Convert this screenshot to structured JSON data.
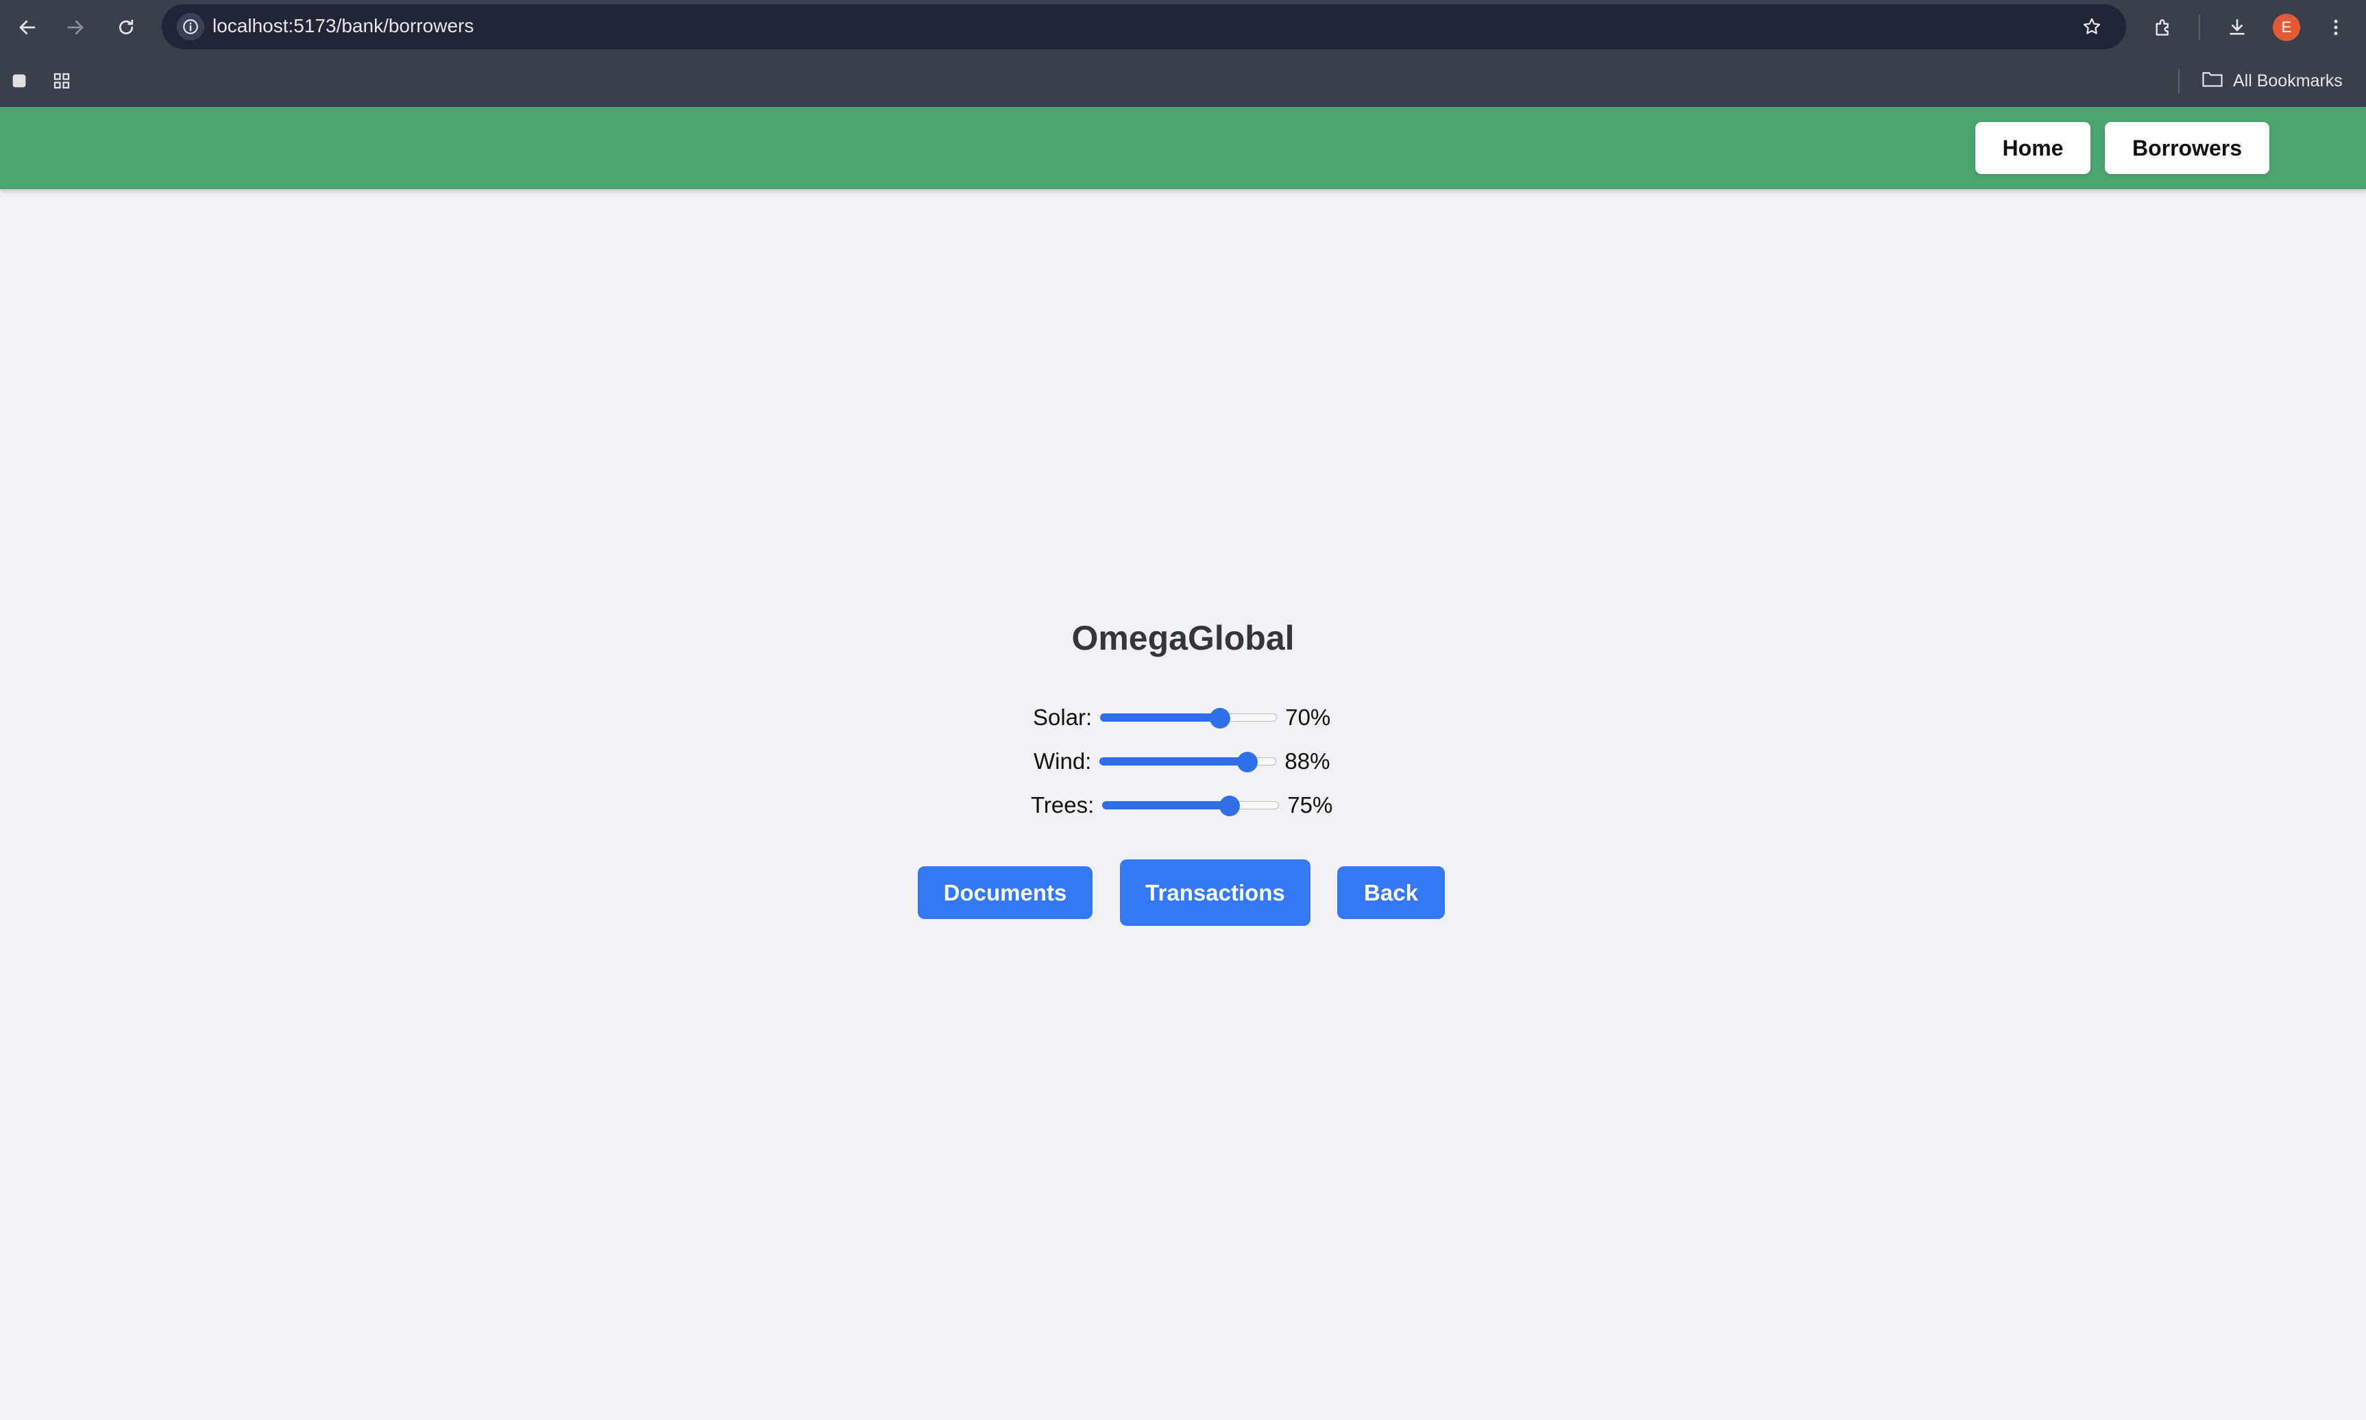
{
  "browser": {
    "url": "localhost:5173/bank/borrowers",
    "avatar_initial": "E",
    "bookmarks_label": "All Bookmarks",
    "icons": [
      "back-arrow-icon",
      "forward-arrow-icon",
      "reload-icon",
      "info-icon",
      "star-icon",
      "extensions-icon",
      "download-icon",
      "kebab-menu-icon",
      "tab-search-icon",
      "apps-grid-icon",
      "folder-icon"
    ]
  },
  "header": {
    "background_color": "#4ba372",
    "home_label": "Home",
    "borrowers_label": "Borrowers"
  },
  "borrower": {
    "name": "OmegaGlobal",
    "sliders": [
      {
        "label": "Solar:",
        "value": 70,
        "display": "70%"
      },
      {
        "label": "Wind:",
        "value": 88,
        "display": "88%"
      },
      {
        "label": "Trees:",
        "value": 75,
        "display": "75%"
      }
    ]
  },
  "actions": {
    "documents_label": "Documents",
    "transactions_label": "Transactions",
    "back_label": "Back",
    "accent_color": "#3478f5"
  }
}
